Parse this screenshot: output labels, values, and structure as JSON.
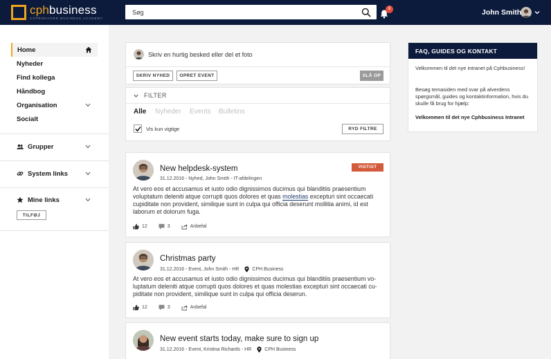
{
  "brand": {
    "name_a": "cph",
    "name_b": "business",
    "tagline": "COPENHAGEN BUSINESS ACADEMY",
    "accent": "#f0a420",
    "navy": "#0c1a3c"
  },
  "header": {
    "search_placeholder": "Søg",
    "notifications": "8",
    "user_name": "John Smith"
  },
  "sidebar": {
    "items": [
      {
        "label": "Home",
        "active": true
      },
      {
        "label": "Nyheder"
      },
      {
        "label": "Find kollega"
      },
      {
        "label": "Håndbog"
      },
      {
        "label": "Organisation",
        "has_children": true
      },
      {
        "label": "Socialt"
      }
    ],
    "sections": [
      {
        "label": "Grupper",
        "icon": "group-icon"
      },
      {
        "label": "System links",
        "icon": "link-icon"
      },
      {
        "label": "Mine links",
        "icon": "star-icon"
      }
    ],
    "add_label": "TILFØJ"
  },
  "composer": {
    "placeholder": "Skriv en hurtig besked eller del et foto",
    "new_post": "SKRIV NYHED",
    "new_event": "OPRET EVENT",
    "post": "SLÅ OP"
  },
  "filter": {
    "toggle_label": "FILTER",
    "tabs": [
      {
        "label": "Alle",
        "active": true
      },
      {
        "label": "Nyheder"
      },
      {
        "label": "Events"
      },
      {
        "label": "Bulletins"
      }
    ],
    "checkbox_label": "Vis kun vigtige",
    "checkbox_checked": true,
    "clear": "RYD FILTRE"
  },
  "posts": [
    {
      "title": "New helpdesk-system",
      "meta": "31.12.2016 - Nyhed, John Smith - IT-afdelingen",
      "badge": "VIGTIGT",
      "body_pre": "At vero eos et accusamus et iusto odio dignissimos ducimus qui blanditiis praesentium voluptatum deleniti atque corrupti quos dolores et quas ",
      "body_hl": "molestias",
      "body_post": " excepturi sint occaecati cupiditate non provident, similique sunt in culpa qui officia deserunt mollitia animi, id est laborum et dolorum fuga.",
      "likes": "12",
      "comments": "3",
      "share": "Anbefal"
    },
    {
      "title": "Christmas party",
      "meta": "31.12.2016 - Event, John Smith - HR",
      "location": "CPH Business",
      "body": "At vero eos et accusamus et iusto odio dignissimos ducimus qui blanditiis praesentium vo-luptatum deleniti atque corrupti quos dolores et quas molestias excepturi sint occaecati cu-piditate non provident, similique sunt in culpa qui officia deserun.",
      "likes": "12",
      "comments": "3",
      "share": "Anbefal"
    },
    {
      "title": "New event starts today, make sure to sign up",
      "meta": "31.12.2016 - Event, Kristina Richards - HR",
      "location": "CPH Business"
    }
  ],
  "faq": {
    "title": "FAQ, GUIDES OG KONTAKT",
    "p1": "Velkommen til det nye intranet på Cphbusiness!",
    "p2": "Besøg temasiden med svar på alverdens spørgsmål, guides og kontaktinformation, hvis du skulle få brug for hjælp:",
    "link": "Velkommen til det nye Cphbusiness Intranet"
  }
}
